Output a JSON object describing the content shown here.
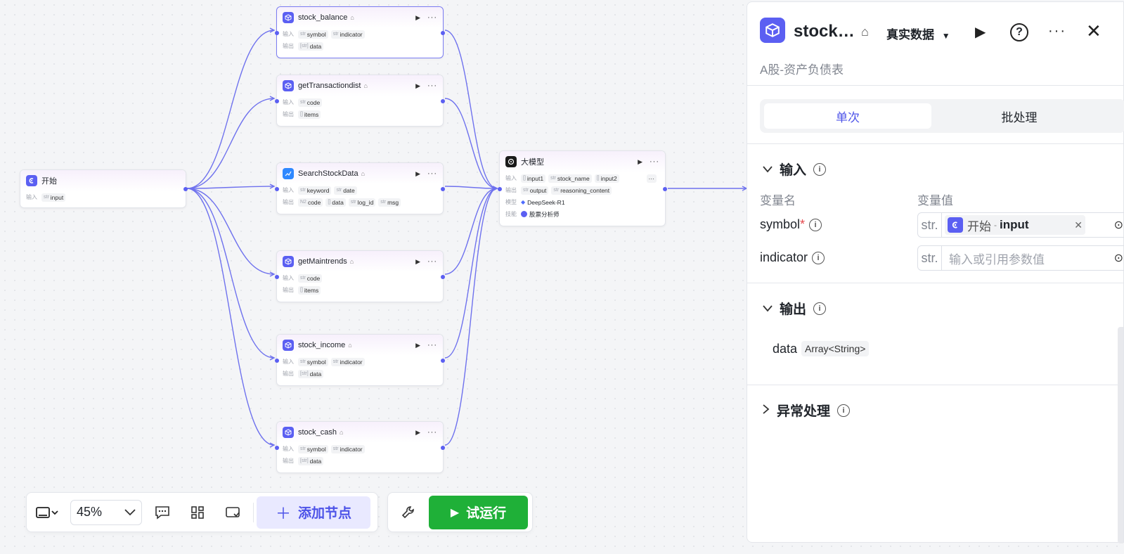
{
  "canvas": {
    "labels": {
      "input": "输入",
      "output": "输出",
      "model": "模型",
      "skill": "技能"
    },
    "nodes": {
      "start": {
        "title": "开始",
        "inputs": [
          {
            "type": "str",
            "name": "input"
          }
        ]
      },
      "stock_balance": {
        "title": "stock_balance",
        "inputs": [
          {
            "type": "str",
            "name": "symbol"
          },
          {
            "type": "str",
            "name": "indicator"
          }
        ],
        "outputs": [
          {
            "type": "[str]",
            "name": "data"
          }
        ]
      },
      "getTransactiondist": {
        "title": "getTransactiondist",
        "inputs": [
          {
            "type": "str",
            "name": "code"
          }
        ],
        "outputs": [
          {
            "type": "[]",
            "name": "items"
          }
        ]
      },
      "SearchStockData": {
        "title": "SearchStockData",
        "inputs": [
          {
            "type": "str",
            "name": "keyword"
          },
          {
            "type": "str",
            "name": "date"
          }
        ],
        "outputs": [
          {
            "type": "N2",
            "name": "code"
          },
          {
            "type": "[]",
            "name": "data"
          },
          {
            "type": "str",
            "name": "log_id"
          },
          {
            "type": "str",
            "name": "msg"
          }
        ]
      },
      "getMaintrends": {
        "title": "getMaintrends",
        "inputs": [
          {
            "type": "str",
            "name": "code"
          }
        ],
        "outputs": [
          {
            "type": "[]",
            "name": "items"
          }
        ]
      },
      "stock_income": {
        "title": "stock_income",
        "inputs": [
          {
            "type": "str",
            "name": "symbol"
          },
          {
            "type": "str",
            "name": "indicator"
          }
        ],
        "outputs": [
          {
            "type": "[str]",
            "name": "data"
          }
        ]
      },
      "stock_cash": {
        "title": "stock_cash",
        "inputs": [
          {
            "type": "str",
            "name": "symbol"
          },
          {
            "type": "str",
            "name": "indicator"
          }
        ],
        "outputs": [
          {
            "type": "[str]",
            "name": "data"
          }
        ]
      },
      "llm": {
        "title": "大模型",
        "inputs": [
          {
            "type": "[]",
            "name": "input1"
          },
          {
            "type": "str",
            "name": "stock_name"
          },
          {
            "type": "[]",
            "name": "input2"
          }
        ],
        "outputs": [
          {
            "type": "str",
            "name": "output"
          },
          {
            "type": "str",
            "name": "reasoning_content"
          }
        ],
        "model": "DeepSeek-R1",
        "skill": "股票分析师"
      }
    }
  },
  "toolbar": {
    "zoom": "45%",
    "add_node_label": "添加节点",
    "run_label": "试运行"
  },
  "panel": {
    "title": "stock…",
    "data_mode": "真实数据",
    "description": "A股-资产负债表",
    "tabs": [
      "单次",
      "批处理"
    ],
    "input_section": "输入",
    "col_var_name": "变量名",
    "col_var_value": "变量值",
    "vars": [
      {
        "name": "symbol",
        "type_label": "str.",
        "ref_node": "开始",
        "ref_sep": "-",
        "ref_var": "input"
      },
      {
        "name": "indicator",
        "type_label": "str.",
        "placeholder": "输入或引用参数值"
      }
    ],
    "output_section": "输出",
    "output_var": {
      "name": "data",
      "type": "Array<String>"
    },
    "exception_section": "异常处理"
  },
  "colors": {
    "accent": "#5b5ff2",
    "run": "#1fb038",
    "edge": "#6f72ee"
  }
}
